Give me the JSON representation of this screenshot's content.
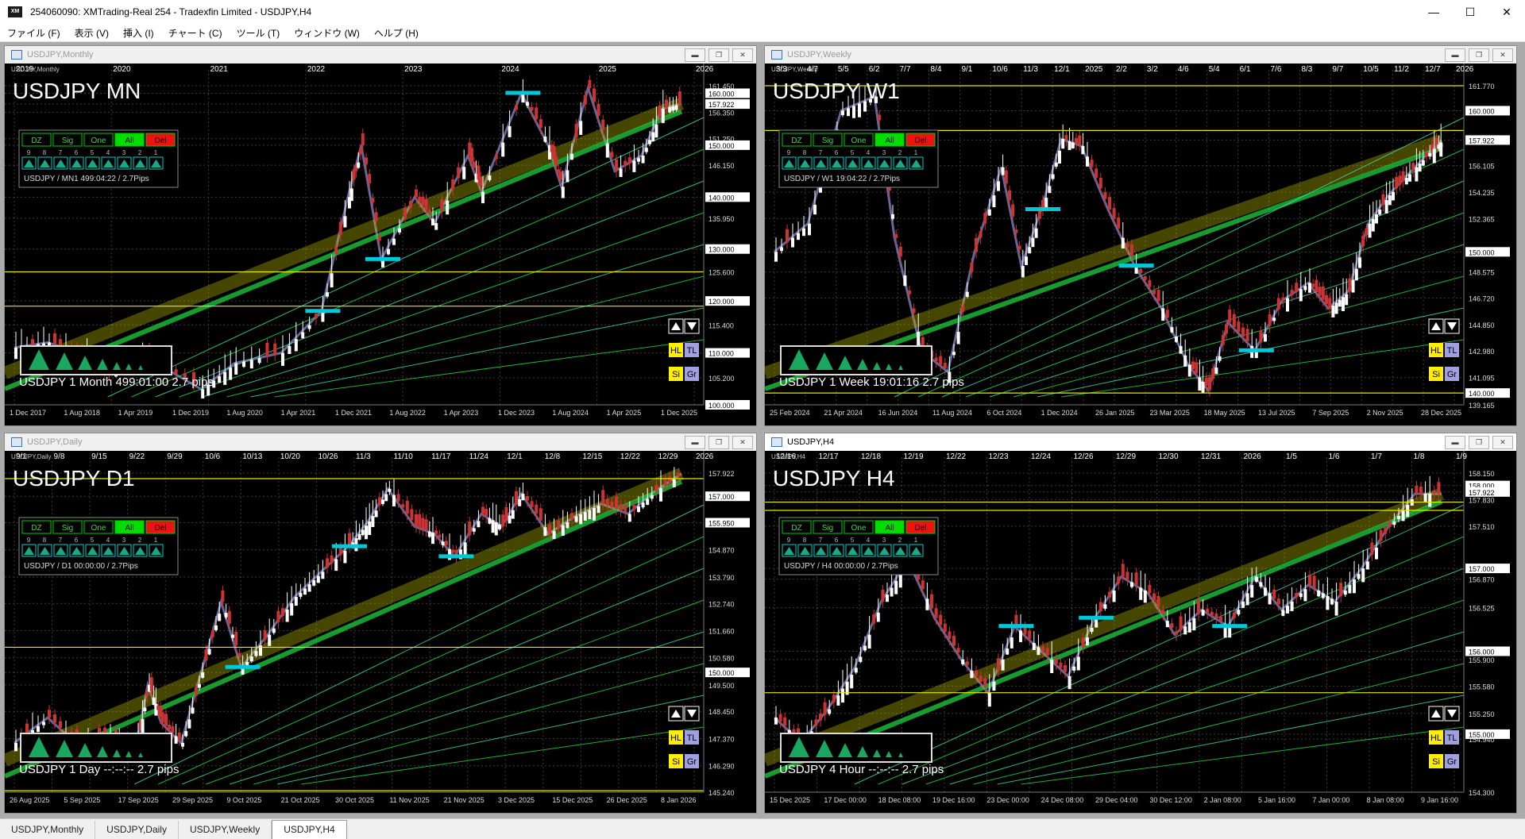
{
  "window": {
    "title": "254060090: XMTrading-Real 254 - Tradexfin Limited - USDJPY,H4",
    "logo_text": "XM"
  },
  "window_controls": {
    "minimize": "—",
    "maximize": "☐",
    "close": "✕"
  },
  "menu": [
    "ファイル (F)",
    "表示 (V)",
    "挿入 (I)",
    "チャート (C)",
    "ツール (T)",
    "ウィンドウ (W)",
    "ヘルプ (H)"
  ],
  "panel_labels": {
    "dz": "DZ",
    "sig": "Sig",
    "one": "One",
    "all": "All",
    "del": "Del",
    "digits": [
      "9",
      "8",
      "7",
      "6",
      "5",
      "4",
      "3",
      "2",
      "1"
    ],
    "hl": "HL",
    "tl": "TL",
    "si": "Si",
    "gr": "Gr"
  },
  "colors": {
    "background": "#000000",
    "grid": "#3a3a3a",
    "up_candle": "#ffffff",
    "down_candle": "#cc3333",
    "channel": "#c8c800",
    "trend": "#22dd44",
    "level": "#e8e800",
    "zone": "#00c8d8",
    "zigzag": "#8888cc"
  },
  "charts": [
    {
      "id": "monthly",
      "window_title": "USDJPY,Monthly",
      "corner_label": "USDJPY,Monthly",
      "big_label": "USDJPY MN",
      "info": "USDJPY / MN1 499:04:22 / 2.7Pips",
      "bottom": "USDJPY  1 Month  499:01:00  2.7 pips",
      "price_labels": [
        "161.450",
        "160.000",
        "157.922",
        "156.350",
        "151.250",
        "150.000",
        "146.150",
        "140.000",
        "135.950",
        "130.000",
        "125.600",
        "120.000",
        "115.400",
        "110.000",
        "105.200",
        "100.000"
      ],
      "top_labels": [
        "2019",
        "2020",
        "2021",
        "2022",
        "2023",
        "2024",
        "2025",
        "2026"
      ],
      "bottom_labels": [
        "1 Dec 2017",
        "1 Aug 2018",
        "1 Apr 2019",
        "1 Dec 2019",
        "1 Aug 2020",
        "1 Apr 2021",
        "1 Dec 2021",
        "1 Aug 2022",
        "1 Apr 2023",
        "1 Dec 2023",
        "1 Aug 2024",
        "1 Apr 2025",
        "1 Dec 2025"
      ],
      "levels": [
        125.6,
        119.0
      ],
      "path": [
        [
          0,
          111
        ],
        [
          0.05,
          112
        ],
        [
          0.1,
          110
        ],
        [
          0.14,
          106
        ],
        [
          0.2,
          109
        ],
        [
          0.28,
          103
        ],
        [
          0.33,
          108
        ],
        [
          0.4,
          110
        ],
        [
          0.46,
          118
        ],
        [
          0.5,
          140
        ],
        [
          0.52,
          150
        ],
        [
          0.55,
          128
        ],
        [
          0.6,
          140
        ],
        [
          0.63,
          135
        ],
        [
          0.68,
          148
        ],
        [
          0.7,
          141
        ],
        [
          0.76,
          160
        ],
        [
          0.8,
          150
        ],
        [
          0.82,
          142
        ],
        [
          0.86,
          161
        ],
        [
          0.9,
          145
        ],
        [
          0.94,
          148
        ],
        [
          0.97,
          157
        ],
        [
          1.0,
          158
        ]
      ]
    },
    {
      "id": "weekly",
      "window_title": "USDJPY,Weekly",
      "corner_label": "USDJPY,Weekly",
      "big_label": "USDJPY W1",
      "info": "USDJPY / W1 19:04:22 / 2.7Pips",
      "bottom": "USDJPY  1 Week  19:01:16  2.7 pips",
      "price_labels": [
        "161.770",
        "160.000",
        "157.922",
        "156.105",
        "154.235",
        "152.365",
        "150.000",
        "148.575",
        "146.720",
        "144.850",
        "142.980",
        "141.095",
        "140.000",
        "139.165"
      ],
      "top_labels": [
        "3/3",
        "4/7",
        "5/5",
        "6/2",
        "7/7",
        "8/4",
        "9/1",
        "10/6",
        "11/3",
        "12/1",
        "2025",
        "2/2",
        "3/2",
        "4/6",
        "5/4",
        "6/1",
        "7/6",
        "8/3",
        "9/7",
        "10/5",
        "11/2",
        "12/7",
        "2026"
      ],
      "bottom_labels": [
        "25 Feb 2024",
        "21 Apr 2024",
        "16 Jun 2024",
        "11 Aug 2024",
        "6 Oct 2024",
        "1 Dec 2024",
        "26 Jan 2025",
        "23 Mar 2025",
        "18 May 2025",
        "13 Jul 2025",
        "7 Sep 2025",
        "2 Nov 2025",
        "28 Dec 2025"
      ],
      "levels": [
        161.77,
        158.6,
        140.0
      ],
      "path": [
        [
          0,
          150
        ],
        [
          0.05,
          152
        ],
        [
          0.1,
          160
        ],
        [
          0.15,
          161
        ],
        [
          0.18,
          151
        ],
        [
          0.22,
          143
        ],
        [
          0.26,
          141.5
        ],
        [
          0.3,
          150
        ],
        [
          0.34,
          156
        ],
        [
          0.37,
          149
        ],
        [
          0.4,
          153
        ],
        [
          0.43,
          158
        ],
        [
          0.46,
          157.5
        ],
        [
          0.5,
          153
        ],
        [
          0.54,
          149
        ],
        [
          0.58,
          146
        ],
        [
          0.62,
          142
        ],
        [
          0.65,
          140.2
        ],
        [
          0.68,
          145
        ],
        [
          0.72,
          143
        ],
        [
          0.76,
          146.5
        ],
        [
          0.8,
          147.8
        ],
        [
          0.83,
          146
        ],
        [
          0.86,
          147.2
        ],
        [
          0.89,
          152
        ],
        [
          0.92,
          154
        ],
        [
          0.95,
          155.5
        ],
        [
          0.98,
          157
        ],
        [
          1.0,
          157.9
        ]
      ]
    },
    {
      "id": "daily",
      "window_title": "USDJPY,Daily",
      "corner_label": "USDJPY,Daily",
      "big_label": "USDJPY D1",
      "info": "USDJPY / D1 00:00:00 / 2.7Pips",
      "bottom": "USDJPY  1 Day  --:--:--  2.7 pips",
      "price_labels": [
        "157.922",
        "157.000",
        "155.950",
        "154.870",
        "153.790",
        "152.740",
        "151.660",
        "150.580",
        "150.000",
        "149.500",
        "148.450",
        "147.370",
        "146.290",
        "145.240"
      ],
      "top_labels": [
        "9/1",
        "9/8",
        "9/15",
        "9/22",
        "9/29",
        "10/6",
        "10/13",
        "10/20",
        "10/26",
        "11/3",
        "11/10",
        "11/17",
        "11/24",
        "12/1",
        "12/8",
        "12/15",
        "12/22",
        "12/29",
        "2026"
      ],
      "bottom_labels": [
        "26 Aug 2025",
        "5 Sep 2025",
        "17 Sep 2025",
        "29 Sep 2025",
        "9 Oct 2025",
        "21 Oct 2025",
        "30 Oct 2025",
        "11 Nov 2025",
        "21 Nov 2025",
        "3 Dec 2025",
        "15 Dec 2025",
        "26 Dec 2025",
        "8 Jan 2026"
      ],
      "levels": [
        157.7,
        151.0,
        145.3
      ],
      "path": [
        [
          0,
          147.2
        ],
        [
          0.05,
          148.2
        ],
        [
          0.1,
          147
        ],
        [
          0.15,
          147.5
        ],
        [
          0.18,
          146.8
        ],
        [
          0.2,
          149.5
        ],
        [
          0.22,
          148
        ],
        [
          0.25,
          147.2
        ],
        [
          0.28,
          150
        ],
        [
          0.31,
          152.8
        ],
        [
          0.34,
          150.2
        ],
        [
          0.38,
          151.5
        ],
        [
          0.42,
          153
        ],
        [
          0.46,
          154
        ],
        [
          0.5,
          155
        ],
        [
          0.53,
          156
        ],
        [
          0.56,
          157.3
        ],
        [
          0.6,
          155.8
        ],
        [
          0.63,
          155.5
        ],
        [
          0.66,
          154.6
        ],
        [
          0.7,
          156.3
        ],
        [
          0.73,
          155.8
        ],
        [
          0.76,
          157.1
        ],
        [
          0.8,
          155.5
        ],
        [
          0.84,
          156.2
        ],
        [
          0.88,
          156.7
        ],
        [
          0.92,
          156.3
        ],
        [
          0.96,
          157.2
        ],
        [
          1.0,
          157.9
        ]
      ]
    },
    {
      "id": "h4",
      "window_title": "USDJPY,H4",
      "corner_label": "USDJPY,H4",
      "big_label": "USDJPY H4",
      "info": "USDJPY / H4 00:00:00 / 2.7Pips",
      "bottom": "USDJPY  4 Hour  --:--:--  2.7 pips",
      "price_labels": [
        "158.150",
        "158.000",
        "157.922",
        "157.830",
        "157.510",
        "157.000",
        "156.870",
        "156.525",
        "156.000",
        "155.900",
        "155.580",
        "155.250",
        "155.000",
        "154.940",
        "154.300"
      ],
      "top_labels": [
        "12/16",
        "12/17",
        "12/18",
        "12/19",
        "12/22",
        "12/23",
        "12/24",
        "12/26",
        "12/29",
        "12/30",
        "12/31",
        "2026",
        "1/5",
        "1/6",
        "1/7",
        "1/8",
        "1/9"
      ],
      "bottom_labels": [
        "15 Dec 2025",
        "17 Dec 00:00",
        "18 Dec 08:00",
        "19 Dec 16:00",
        "23 Dec 00:00",
        "24 Dec 08:00",
        "29 Dec 04:00",
        "30 Dec 12:00",
        "2 Jan 08:00",
        "5 Jan 16:00",
        "7 Jan 00:00",
        "8 Jan 08:00",
        "9 Jan 16:00"
      ],
      "levels": [
        157.8,
        157.7,
        155.5
      ],
      "path": [
        [
          0,
          155.2
        ],
        [
          0.04,
          154.9
        ],
        [
          0.08,
          155.3
        ],
        [
          0.12,
          155.8
        ],
        [
          0.16,
          156.6
        ],
        [
          0.2,
          157.1
        ],
        [
          0.24,
          156.4
        ],
        [
          0.28,
          155.9
        ],
        [
          0.32,
          155.5
        ],
        [
          0.36,
          156.3
        ],
        [
          0.4,
          156.0
        ],
        [
          0.44,
          155.7
        ],
        [
          0.48,
          156.4
        ],
        [
          0.52,
          156.9
        ],
        [
          0.56,
          156.7
        ],
        [
          0.6,
          156.2
        ],
        [
          0.64,
          156.5
        ],
        [
          0.68,
          156.3
        ],
        [
          0.72,
          156.9
        ],
        [
          0.76,
          156.5
        ],
        [
          0.8,
          156.8
        ],
        [
          0.84,
          156.6
        ],
        [
          0.88,
          157.0
        ],
        [
          0.92,
          157.5
        ],
        [
          0.96,
          157.9
        ],
        [
          1.0,
          157.9
        ]
      ]
    }
  ],
  "tabs": [
    "USDJPY,Monthly",
    "USDJPY,Daily",
    "USDJPY,Weekly",
    "USDJPY,H4"
  ]
}
